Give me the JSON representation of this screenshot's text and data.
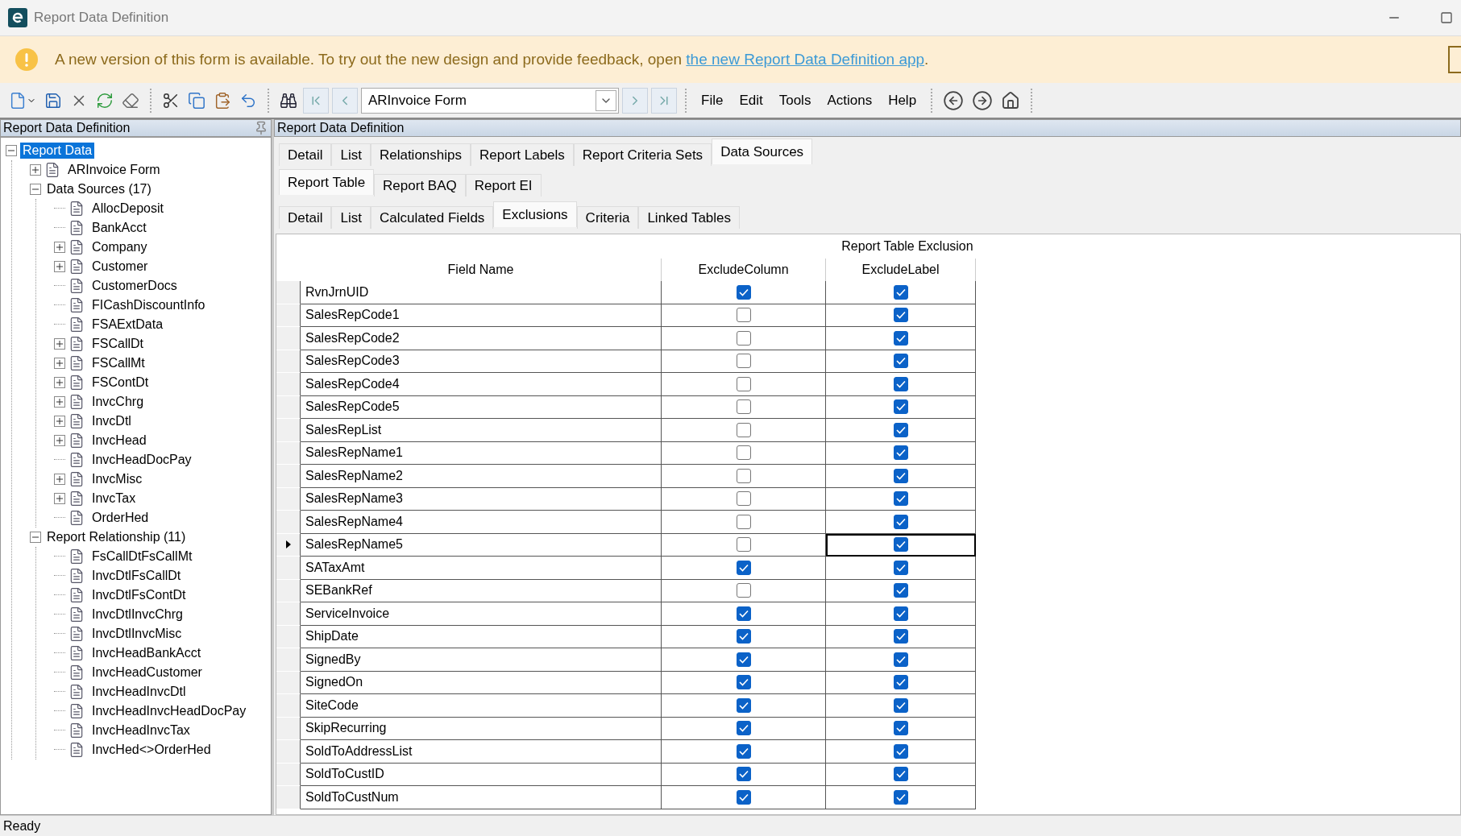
{
  "window": {
    "title": "Report Data Definition"
  },
  "banner": {
    "message": "A new version of this form is available. To try out the new design and provide feedback, open",
    "link": "the new Report Data Definition app",
    "suffix": "."
  },
  "toolbar": {
    "record": {
      "value": "ARInvoice Form"
    },
    "menu": [
      "File",
      "Edit",
      "Tools",
      "Actions",
      "Help"
    ]
  },
  "tree_panel": {
    "title": "Report Data Definition",
    "tree": [
      {
        "label": "Report Data",
        "kind": "group",
        "selected": true,
        "children": [
          {
            "label": "ARInvoice Form",
            "kind": "collapsed",
            "selected": false
          },
          {
            "label": "Data Sources (17)",
            "kind": "group",
            "selected": false,
            "children": [
              {
                "label": "AllocDeposit",
                "kind": "leaf",
                "selected": false
              },
              {
                "label": "BankAcct",
                "kind": "leaf",
                "selected": false
              },
              {
                "label": "Company",
                "kind": "collapsed",
                "selected": false
              },
              {
                "label": "Customer",
                "kind": "collapsed",
                "selected": false
              },
              {
                "label": "CustomerDocs",
                "kind": "leaf",
                "selected": false
              },
              {
                "label": "FICashDiscountInfo",
                "kind": "leaf",
                "selected": false
              },
              {
                "label": "FSAExtData",
                "kind": "leaf",
                "selected": false
              },
              {
                "label": "FSCallDt",
                "kind": "collapsed",
                "selected": false
              },
              {
                "label": "FSCallMt",
                "kind": "collapsed",
                "selected": false
              },
              {
                "label": "FSContDt",
                "kind": "collapsed",
                "selected": false
              },
              {
                "label": "InvcChrg",
                "kind": "collapsed",
                "selected": false
              },
              {
                "label": "InvcDtl",
                "kind": "collapsed",
                "selected": false
              },
              {
                "label": "InvcHead",
                "kind": "collapsed",
                "selected": false
              },
              {
                "label": "InvcHeadDocPay",
                "kind": "leaf",
                "selected": false
              },
              {
                "label": "InvcMisc",
                "kind": "collapsed",
                "selected": false
              },
              {
                "label": "InvcTax",
                "kind": "collapsed",
                "selected": false
              },
              {
                "label": "OrderHed",
                "kind": "leaf",
                "selected": false
              }
            ]
          },
          {
            "label": "Report Relationship (11)",
            "kind": "group",
            "selected": false,
            "children": [
              {
                "label": "FsCallDtFsCallMt",
                "kind": "leaf",
                "selected": false
              },
              {
                "label": "InvcDtlFsCallDt",
                "kind": "leaf",
                "selected": false
              },
              {
                "label": "InvcDtlFsContDt",
                "kind": "leaf",
                "selected": false
              },
              {
                "label": "InvcDtlInvcChrg",
                "kind": "leaf",
                "selected": false
              },
              {
                "label": "InvcDtlInvcMisc",
                "kind": "leaf",
                "selected": false
              },
              {
                "label": "InvcHeadBankAcct",
                "kind": "leaf",
                "selected": false
              },
              {
                "label": "InvcHeadCustomer",
                "kind": "leaf",
                "selected": false
              },
              {
                "label": "InvcHeadInvcDtl",
                "kind": "leaf",
                "selected": false
              },
              {
                "label": "InvcHeadInvcHeadDocPay",
                "kind": "leaf",
                "selected": false
              },
              {
                "label": "InvcHeadInvcTax",
                "kind": "leaf",
                "selected": false
              },
              {
                "label": "InvcHed<>OrderHed",
                "kind": "leaf",
                "selected": false
              }
            ]
          }
        ]
      }
    ]
  },
  "main_panel": {
    "title": "Report Data Definition",
    "tabs": [
      {
        "label": "Detail",
        "selected": false
      },
      {
        "label": "List",
        "selected": false
      },
      {
        "label": "Relationships",
        "selected": false
      },
      {
        "label": "Report Labels",
        "selected": false
      },
      {
        "label": "Report Criteria Sets",
        "selected": false
      },
      {
        "label": "Data Sources",
        "selected": true
      }
    ],
    "subtabs": [
      {
        "label": "Report Table",
        "selected": true
      },
      {
        "label": "Report BAQ",
        "selected": false
      },
      {
        "label": "Report EI",
        "selected": false
      }
    ],
    "table_tabs": [
      {
        "label": "Detail",
        "selected": false
      },
      {
        "label": "List",
        "selected": false
      },
      {
        "label": "Calculated Fields",
        "selected": false
      },
      {
        "label": "Exclusions",
        "selected": true
      },
      {
        "label": "Criteria",
        "selected": false
      },
      {
        "label": "Linked Tables",
        "selected": false
      }
    ],
    "grid": {
      "group_header": "Report Table Exclusion",
      "columns": [
        "Field Name",
        "ExcludeColumn",
        "ExcludeLabel"
      ],
      "rows": [
        {
          "field": "RvnJrnUID",
          "exclude_column": true,
          "exclude_label": true,
          "current": false
        },
        {
          "field": "SalesRepCode1",
          "exclude_column": false,
          "exclude_label": true,
          "current": false
        },
        {
          "field": "SalesRepCode2",
          "exclude_column": false,
          "exclude_label": true,
          "current": false
        },
        {
          "field": "SalesRepCode3",
          "exclude_column": false,
          "exclude_label": true,
          "current": false
        },
        {
          "field": "SalesRepCode4",
          "exclude_column": false,
          "exclude_label": true,
          "current": false
        },
        {
          "field": "SalesRepCode5",
          "exclude_column": false,
          "exclude_label": true,
          "current": false
        },
        {
          "field": "SalesRepList",
          "exclude_column": false,
          "exclude_label": true,
          "current": false
        },
        {
          "field": "SalesRepName1",
          "exclude_column": false,
          "exclude_label": true,
          "current": false
        },
        {
          "field": "SalesRepName2",
          "exclude_column": false,
          "exclude_label": true,
          "current": false
        },
        {
          "field": "SalesRepName3",
          "exclude_column": false,
          "exclude_label": true,
          "current": false
        },
        {
          "field": "SalesRepName4",
          "exclude_column": false,
          "exclude_label": true,
          "current": false
        },
        {
          "field": "SalesRepName5",
          "exclude_column": false,
          "exclude_label": true,
          "current": true
        },
        {
          "field": "SATaxAmt",
          "exclude_column": true,
          "exclude_label": true,
          "current": false
        },
        {
          "field": "SEBankRef",
          "exclude_column": false,
          "exclude_label": true,
          "current": false
        },
        {
          "field": "ServiceInvoice",
          "exclude_column": true,
          "exclude_label": true,
          "current": false
        },
        {
          "field": "ShipDate",
          "exclude_column": true,
          "exclude_label": true,
          "current": false
        },
        {
          "field": "SignedBy",
          "exclude_column": true,
          "exclude_label": true,
          "current": false
        },
        {
          "field": "SignedOn",
          "exclude_column": true,
          "exclude_label": true,
          "current": false
        },
        {
          "field": "SiteCode",
          "exclude_column": true,
          "exclude_label": true,
          "current": false
        },
        {
          "field": "SkipRecurring",
          "exclude_column": true,
          "exclude_label": true,
          "current": false
        },
        {
          "field": "SoldToAddressList",
          "exclude_column": true,
          "exclude_label": true,
          "current": false
        },
        {
          "field": "SoldToCustID",
          "exclude_column": true,
          "exclude_label": true,
          "current": false
        },
        {
          "field": "SoldToCustNum",
          "exclude_column": true,
          "exclude_label": true,
          "current": false
        }
      ]
    }
  },
  "status_bar": {
    "text": "Ready"
  }
}
